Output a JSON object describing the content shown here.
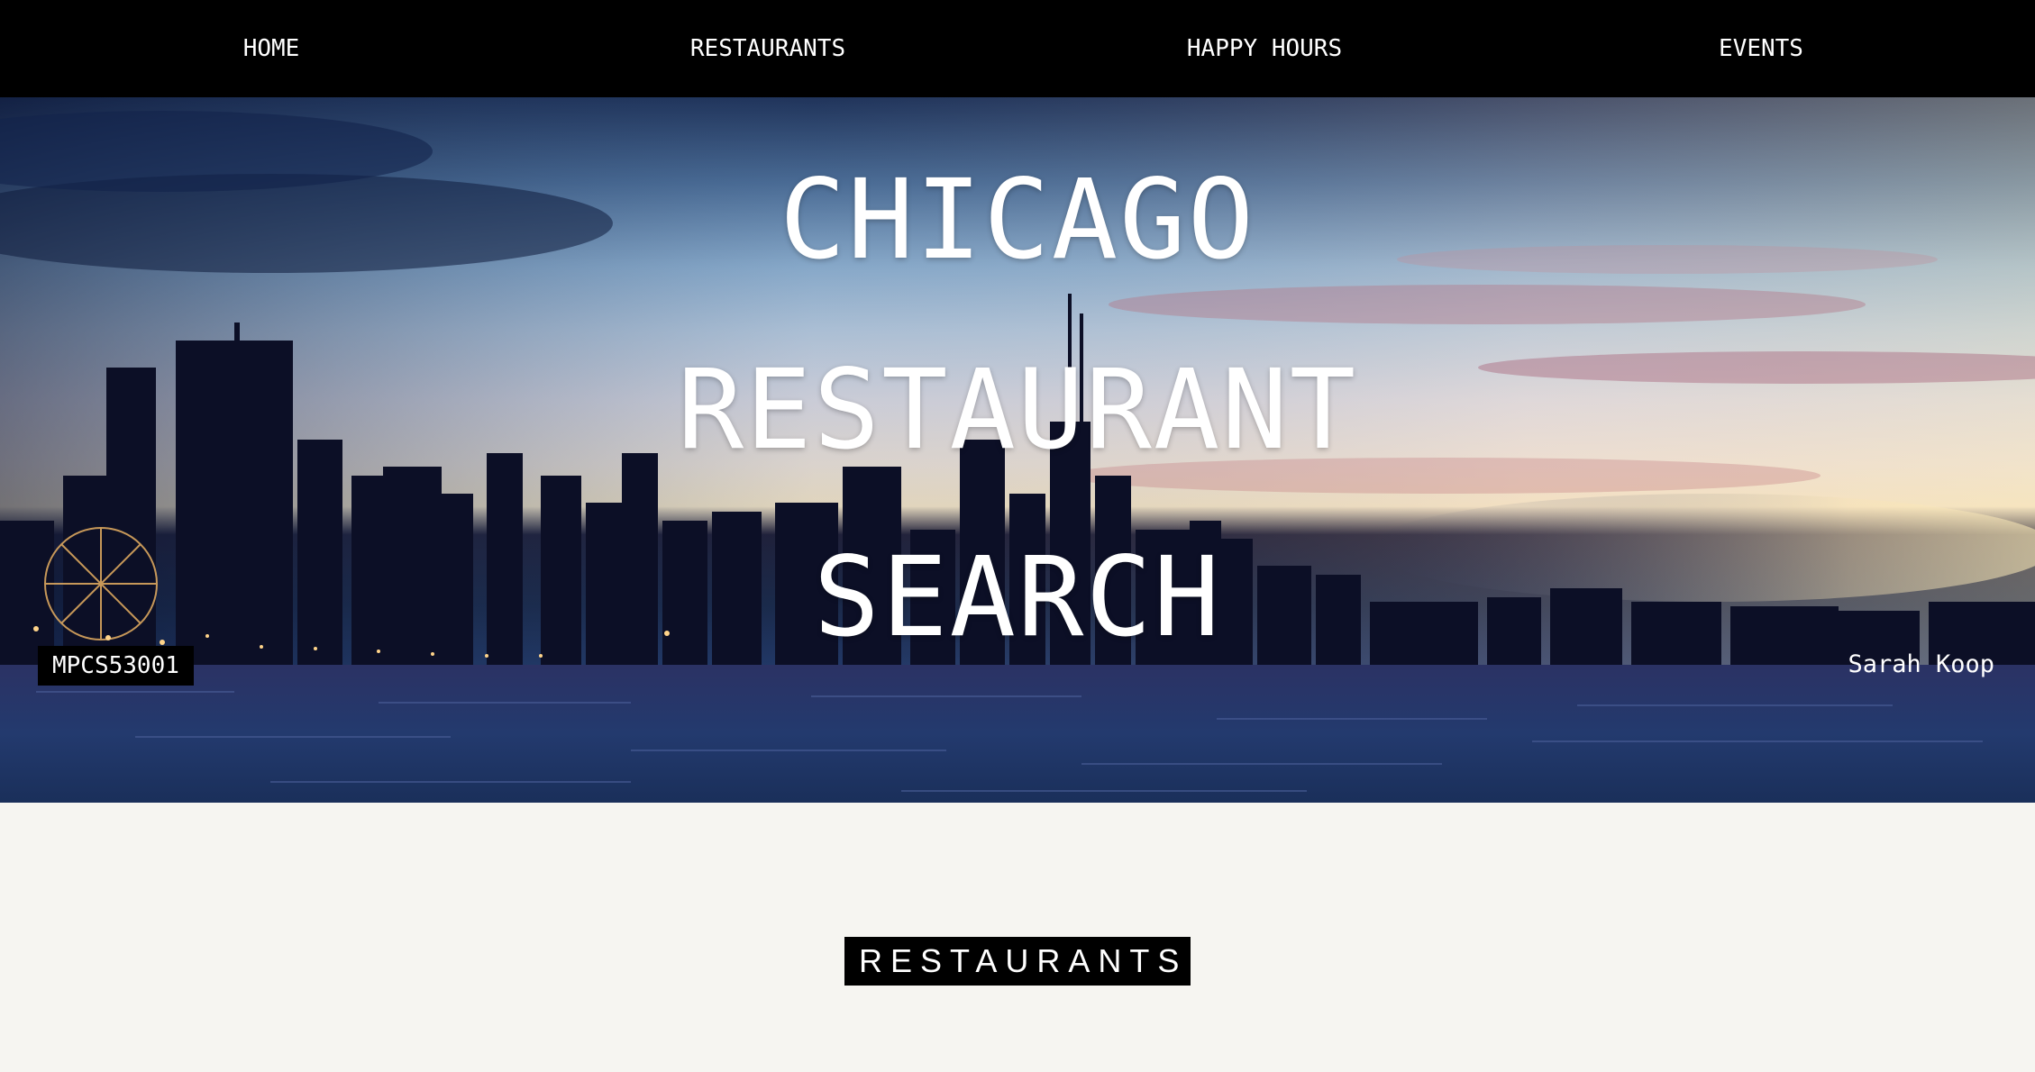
{
  "nav": {
    "items": [
      {
        "label": "HOME"
      },
      {
        "label": "RESTAURANTS"
      },
      {
        "label": "HAPPY HOURS"
      },
      {
        "label": "EVENTS"
      }
    ]
  },
  "hero": {
    "title_lines": [
      "CHICAGO",
      "RESTAURANT",
      "SEARCH"
    ],
    "badge": "MPCS53001",
    "author": "Sarah Koop",
    "background_image": "chicago-skyline-sunset"
  },
  "section": {
    "heading": "RESTAURANTS"
  },
  "colors": {
    "nav_bg": "#000000",
    "nav_text": "#ffffff",
    "page_bg": "#f6f5f1",
    "heading_bg": "#000000",
    "heading_text": "#ffffff"
  }
}
